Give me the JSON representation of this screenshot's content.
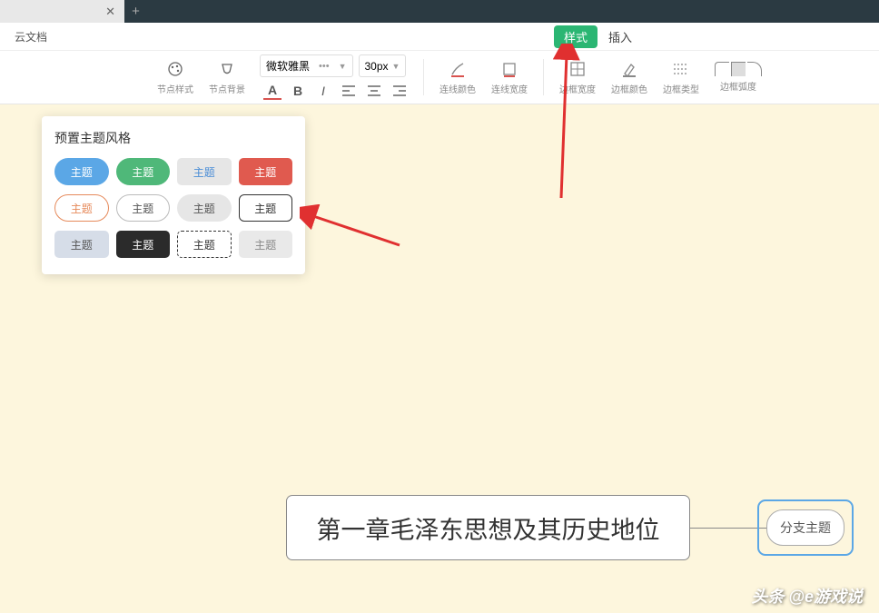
{
  "app_title": "云文档",
  "menu": {
    "style": "样式",
    "insert": "插入"
  },
  "toolbar": {
    "node_style": "节点样式",
    "node_bg": "节点背景",
    "font_name": "微软雅黑",
    "font_size": "30px",
    "line_color": "连线颜色",
    "line_width": "连线宽度",
    "border_width": "边框宽度",
    "border_color": "边框颜色",
    "border_type": "边框类型",
    "border_radius": "边框弧度"
  },
  "theme_panel": {
    "title": "预置主题风格",
    "label": "主题"
  },
  "mindmap": {
    "main": "第一章毛泽东思想及其历史地位",
    "branch": "分支主题"
  },
  "watermark": "头条 @e游戏说"
}
